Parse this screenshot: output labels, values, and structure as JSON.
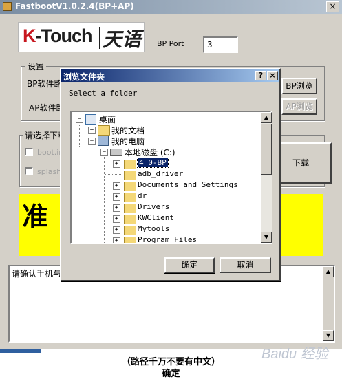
{
  "window": {
    "title": "FastbootV1.0.2.4(BP+AP)",
    "close_glyph": "×"
  },
  "logo": {
    "brand_k": "K",
    "brand_rest": "-Touch",
    "brand_cn": "天语",
    "brand_color": "#c7161e"
  },
  "bp_port": {
    "label": "BP Port",
    "value": "3"
  },
  "settings": {
    "title": "设置",
    "bp_path_label": "BP软件路",
    "ap_path_label": "AP软件路",
    "bp_browse_label": "BP浏览",
    "ap_browse_label": "AP浏览"
  },
  "download": {
    "group_title": "请选择下载",
    "boot_label": "boot.im",
    "splash_label": "splash.",
    "download_button": "下载"
  },
  "status": {
    "text": "准",
    "color": "#ffff00"
  },
  "log": {
    "text": "请确认手机与"
  },
  "dialog": {
    "title": "浏览文件夹",
    "help_glyph": "?",
    "close_glyph": "×",
    "prompt": "Select a folder",
    "ok_label": "确定",
    "cancel_label": "取消",
    "tree": {
      "desktop": "桌面",
      "my_documents": "我的文档",
      "my_computer": "我的电脑",
      "local_disk": "本地磁盘 (C:)",
      "folders": [
        {
          "label": "4 0-BP",
          "selected": true,
          "expander": "+"
        },
        {
          "label": "adb_driver",
          "selected": false,
          "expander": ""
        },
        {
          "label": "Documents and Settings",
          "selected": false,
          "expander": "+"
        },
        {
          "label": "dr",
          "selected": false,
          "expander": "+"
        },
        {
          "label": "Drivers",
          "selected": false,
          "expander": "+"
        },
        {
          "label": "KWClient",
          "selected": false,
          "expander": "+"
        },
        {
          "label": "Mytools",
          "selected": false,
          "expander": "+"
        },
        {
          "label": "Program Files",
          "selected": false,
          "expander": "+"
        }
      ]
    }
  },
  "captions": {
    "line1": "（路径千万不要有中文）",
    "line2": "确定"
  },
  "watermark": "Baidu 经验"
}
